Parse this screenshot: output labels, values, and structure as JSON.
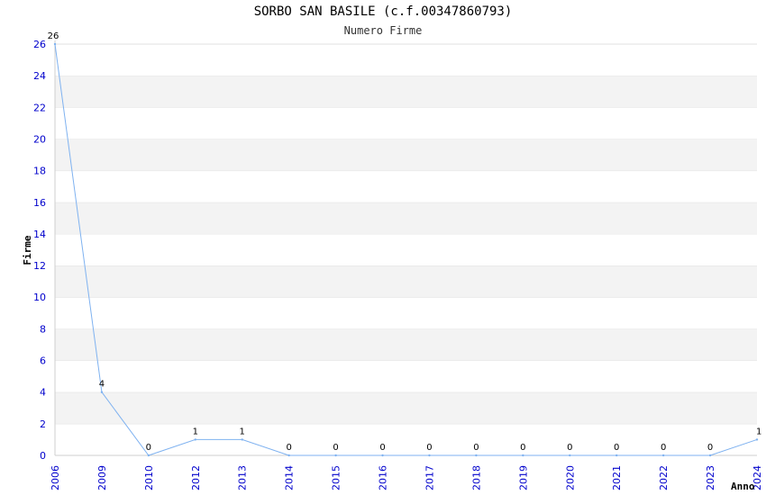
{
  "title": "SORBO SAN BASILE (c.f.00347860793)",
  "subtitle": "Numero Firme",
  "chart_data": {
    "type": "line",
    "x": [
      "2006",
      "2009",
      "2010",
      "2012",
      "2013",
      "2014",
      "2015",
      "2016",
      "2017",
      "2018",
      "2019",
      "2020",
      "2021",
      "2022",
      "2023",
      "2024"
    ],
    "series": [
      {
        "values": [
          26,
          4,
          0,
          1,
          1,
          0,
          0,
          0,
          0,
          0,
          0,
          0,
          0,
          0,
          0,
          1
        ]
      }
    ],
    "ylabel": "Firme",
    "xlabel": "Anno",
    "ylim": [
      0,
      26
    ],
    "yticks": [
      0,
      2,
      4,
      6,
      8,
      10,
      12,
      14,
      16,
      18,
      20,
      22,
      24,
      26
    ],
    "grid": "horizontal alternating bands",
    "colors": {
      "line": "#7fb2f0",
      "band": "#f3f3f3",
      "tick": "#0000cc"
    }
  }
}
